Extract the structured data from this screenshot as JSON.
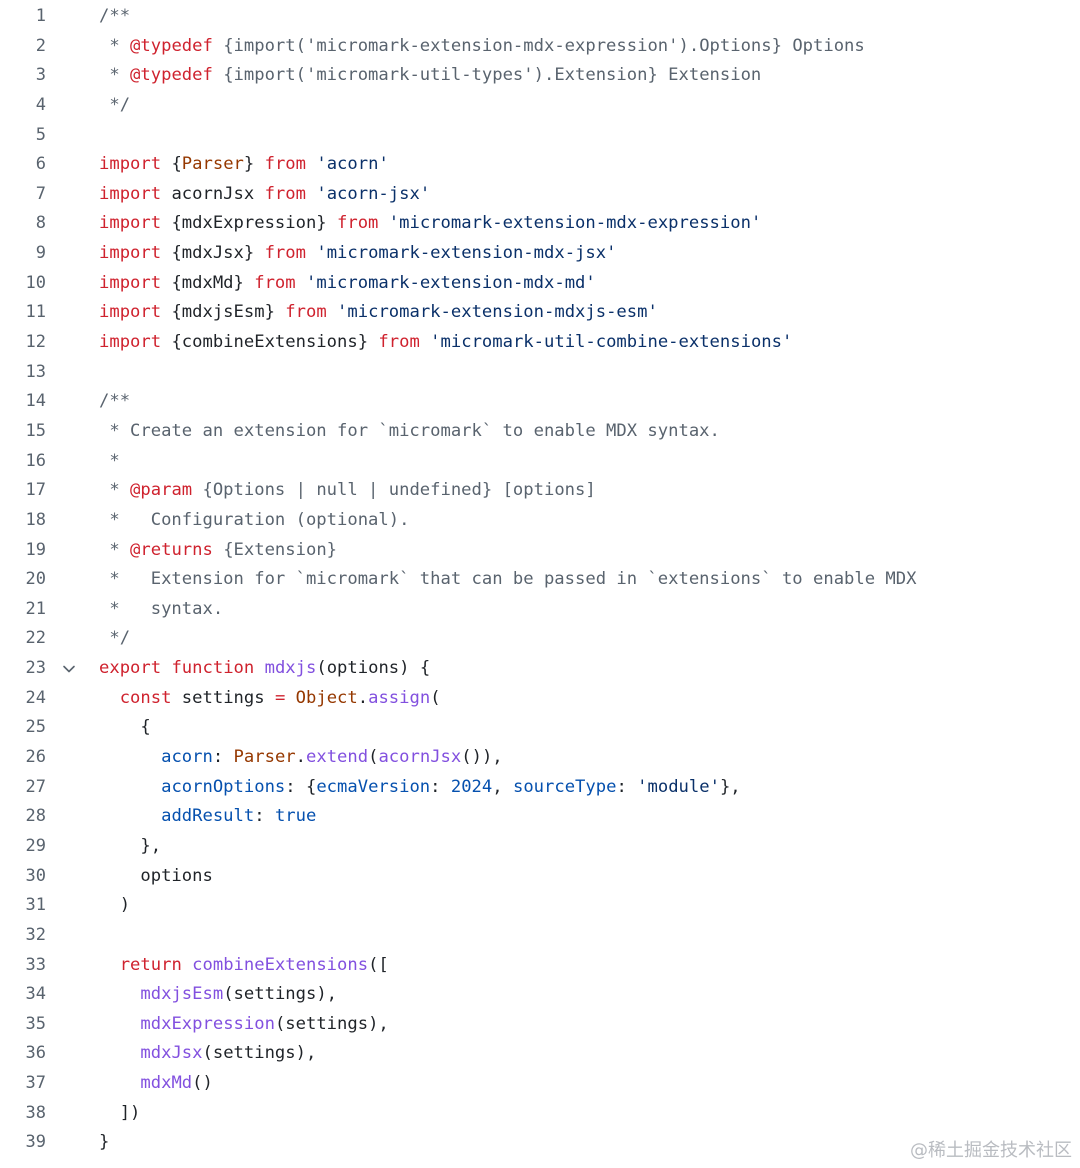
{
  "editor": {
    "fold_icon": "chevron-down-icon",
    "lines": [
      [
        {
          "t": "/**",
          "c": "c"
        }
      ],
      [
        {
          "t": " * ",
          "c": "c"
        },
        {
          "t": "@typedef",
          "c": "k"
        },
        {
          "t": " {import('micromark-extension-mdx-expression').Options} Options",
          "c": "c"
        }
      ],
      [
        {
          "t": " * ",
          "c": "c"
        },
        {
          "t": "@typedef",
          "c": "k"
        },
        {
          "t": " {import('micromark-util-types').Extension} Extension",
          "c": "c"
        }
      ],
      [
        {
          "t": " */",
          "c": "c"
        }
      ],
      [],
      [
        {
          "t": "import",
          "c": "k"
        },
        {
          "t": " {"
        },
        {
          "t": "Parser",
          "c": "v"
        },
        {
          "t": "} "
        },
        {
          "t": "from",
          "c": "k"
        },
        {
          "t": " "
        },
        {
          "t": "'acorn'",
          "c": "s"
        }
      ],
      [
        {
          "t": "import",
          "c": "k"
        },
        {
          "t": " acornJsx "
        },
        {
          "t": "from",
          "c": "k"
        },
        {
          "t": " "
        },
        {
          "t": "'acorn-jsx'",
          "c": "s"
        }
      ],
      [
        {
          "t": "import",
          "c": "k"
        },
        {
          "t": " {mdxExpression} "
        },
        {
          "t": "from",
          "c": "k"
        },
        {
          "t": " "
        },
        {
          "t": "'micromark-extension-mdx-expression'",
          "c": "s"
        }
      ],
      [
        {
          "t": "import",
          "c": "k"
        },
        {
          "t": " {mdxJsx} "
        },
        {
          "t": "from",
          "c": "k"
        },
        {
          "t": " "
        },
        {
          "t": "'micromark-extension-mdx-jsx'",
          "c": "s"
        }
      ],
      [
        {
          "t": "import",
          "c": "k"
        },
        {
          "t": " {mdxMd} "
        },
        {
          "t": "from",
          "c": "k"
        },
        {
          "t": " "
        },
        {
          "t": "'micromark-extension-mdx-md'",
          "c": "s"
        }
      ],
      [
        {
          "t": "import",
          "c": "k"
        },
        {
          "t": " {mdxjsEsm} "
        },
        {
          "t": "from",
          "c": "k"
        },
        {
          "t": " "
        },
        {
          "t": "'micromark-extension-mdxjs-esm'",
          "c": "s"
        }
      ],
      [
        {
          "t": "import",
          "c": "k"
        },
        {
          "t": " {combineExtensions} "
        },
        {
          "t": "from",
          "c": "k"
        },
        {
          "t": " "
        },
        {
          "t": "'micromark-util-combine-extensions'",
          "c": "s"
        }
      ],
      [],
      [
        {
          "t": "/**",
          "c": "c"
        }
      ],
      [
        {
          "t": " * Create an extension for `micromark` to enable MDX syntax.",
          "c": "c"
        }
      ],
      [
        {
          "t": " *",
          "c": "c"
        }
      ],
      [
        {
          "t": " * ",
          "c": "c"
        },
        {
          "t": "@param",
          "c": "k"
        },
        {
          "t": " {Options | null | undefined} ",
          "c": "c"
        },
        {
          "t": "[options]",
          "c": "c"
        }
      ],
      [
        {
          "t": " *   Configuration (optional).",
          "c": "c"
        }
      ],
      [
        {
          "t": " * ",
          "c": "c"
        },
        {
          "t": "@returns",
          "c": "k"
        },
        {
          "t": " {Extension}",
          "c": "c"
        }
      ],
      [
        {
          "t": " *   Extension for `micromark` that can be passed in `extensions` to enable MDX",
          "c": "c"
        }
      ],
      [
        {
          "t": " *   syntax.",
          "c": "c"
        }
      ],
      [
        {
          "t": " */",
          "c": "c"
        }
      ],
      [
        {
          "t": "export",
          "c": "k"
        },
        {
          "t": " "
        },
        {
          "t": "function",
          "c": "k"
        },
        {
          "t": " "
        },
        {
          "t": "mdxjs",
          "c": "f"
        },
        {
          "t": "(options) {"
        }
      ],
      [
        {
          "t": "  "
        },
        {
          "t": "const",
          "c": "k"
        },
        {
          "t": " settings "
        },
        {
          "t": "=",
          "c": "k"
        },
        {
          "t": " "
        },
        {
          "t": "Object",
          "c": "v"
        },
        {
          "t": "."
        },
        {
          "t": "assign",
          "c": "f"
        },
        {
          "t": "("
        }
      ],
      [
        {
          "t": "    {"
        }
      ],
      [
        {
          "t": "      "
        },
        {
          "t": "acorn",
          "c": "p"
        },
        {
          "t": ": "
        },
        {
          "t": "Parser",
          "c": "v"
        },
        {
          "t": "."
        },
        {
          "t": "extend",
          "c": "f"
        },
        {
          "t": "("
        },
        {
          "t": "acornJsx",
          "c": "f"
        },
        {
          "t": "()),"
        }
      ],
      [
        {
          "t": "      "
        },
        {
          "t": "acornOptions",
          "c": "p"
        },
        {
          "t": ": {"
        },
        {
          "t": "ecmaVersion",
          "c": "p"
        },
        {
          "t": ": "
        },
        {
          "t": "2024",
          "c": "p"
        },
        {
          "t": ", "
        },
        {
          "t": "sourceType",
          "c": "p"
        },
        {
          "t": ": "
        },
        {
          "t": "'module'",
          "c": "s"
        },
        {
          "t": "},"
        }
      ],
      [
        {
          "t": "      "
        },
        {
          "t": "addResult",
          "c": "p"
        },
        {
          "t": ": "
        },
        {
          "t": "true",
          "c": "p"
        }
      ],
      [
        {
          "t": "    },"
        }
      ],
      [
        {
          "t": "    options"
        }
      ],
      [
        {
          "t": "  )"
        }
      ],
      [],
      [
        {
          "t": "  "
        },
        {
          "t": "return",
          "c": "k"
        },
        {
          "t": " "
        },
        {
          "t": "combineExtensions",
          "c": "f"
        },
        {
          "t": "(["
        }
      ],
      [
        {
          "t": "    "
        },
        {
          "t": "mdxjsEsm",
          "c": "f"
        },
        {
          "t": "(settings),"
        }
      ],
      [
        {
          "t": "    "
        },
        {
          "t": "mdxExpression",
          "c": "f"
        },
        {
          "t": "(settings),"
        }
      ],
      [
        {
          "t": "    "
        },
        {
          "t": "mdxJsx",
          "c": "f"
        },
        {
          "t": "(settings),"
        }
      ],
      [
        {
          "t": "    "
        },
        {
          "t": "mdxMd",
          "c": "f"
        },
        {
          "t": "()"
        }
      ],
      [
        {
          "t": "  ])"
        }
      ],
      [
        {
          "t": "}"
        }
      ]
    ],
    "fold_lines": [
      23
    ]
  },
  "watermark": "@稀土掘金技术社区"
}
